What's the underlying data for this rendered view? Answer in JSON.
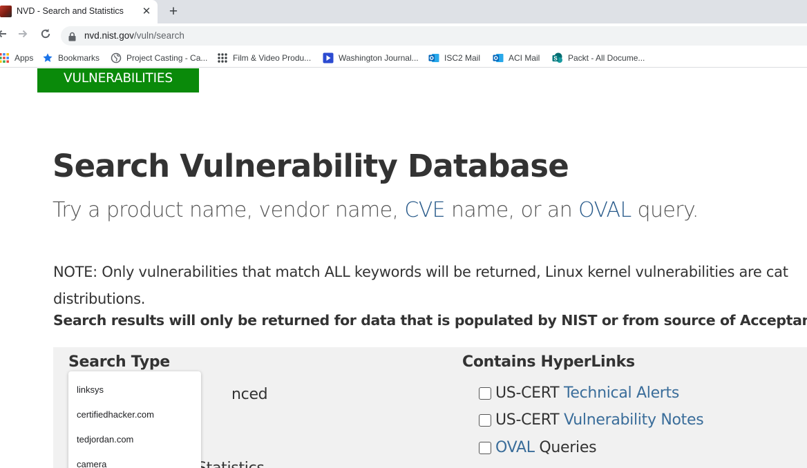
{
  "browser": {
    "tab_title": "NVD - Search and Statistics",
    "tab_close": "✕",
    "new_tab": "+",
    "url_host": "nvd.nist.gov",
    "url_path": "/vuln/search"
  },
  "bookmarks": [
    {
      "label": "Apps",
      "icon": "apps-grid-icon"
    },
    {
      "label": "Bookmarks",
      "icon": "star-icon"
    },
    {
      "label": "Project Casting - Ca...",
      "icon": "globe-icon"
    },
    {
      "label": "Film & Video Produ...",
      "icon": "dots-grid-icon"
    },
    {
      "label": "Washington Journal...",
      "icon": "play-icon"
    },
    {
      "label": "ISC2 Mail",
      "icon": "outlook-icon"
    },
    {
      "label": "ACI Mail",
      "icon": "outlook-icon"
    },
    {
      "label": "Packt - All Docume...",
      "icon": "sharepoint-icon"
    }
  ],
  "page": {
    "vulnerabilities_button": "VULNERABILITIES",
    "title": "Search Vulnerability Database",
    "subtitle_1": "Try a product name, vendor name, ",
    "subtitle_cve": "CVE",
    "subtitle_2": " name, or an ",
    "subtitle_oval": "OVAL",
    "subtitle_3": " query.",
    "note_line1": "NOTE: Only vulnerabilities that match ALL keywords will be returned, Linux kernel vulnerabilities are cat",
    "note_line2": "distributions.",
    "note_bold": "Search results will only be returned for data that is populated by NIST or from source of Acceptance"
  },
  "search_panel": {
    "search_type_heading": "Search Type",
    "search_type_partial": "nced",
    "search_type_partial2": "Statistics",
    "contains_heading": "Contains HyperLinks",
    "links": [
      {
        "prefix": "US-CERT ",
        "link": "Technical Alerts",
        "suffix": ""
      },
      {
        "prefix": "US-CERT ",
        "link": "Vulnerability Notes",
        "suffix": ""
      },
      {
        "prefix": "",
        "link": "OVAL",
        "suffix": " Queries"
      }
    ]
  },
  "autocomplete": [
    "linksys",
    "certifiedhacker.com",
    "tedjordan.com",
    "camera"
  ],
  "colors": {
    "accent_green": "#0a8a0a",
    "link_blue": "#3a6d9a"
  }
}
